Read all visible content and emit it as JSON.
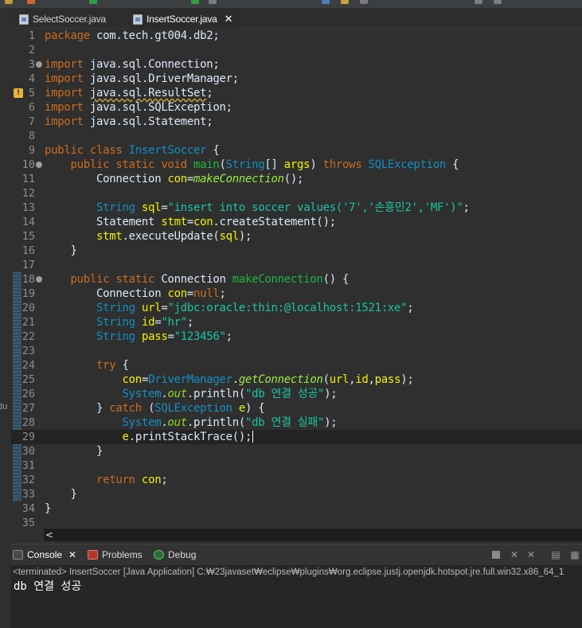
{
  "editor_tabs": [
    {
      "label": "SelectSoccer.java",
      "active": false
    },
    {
      "label": "InsertSoccer.java",
      "active": true,
      "close": "✕"
    }
  ],
  "left_margin_label": "du",
  "code_lines": [
    {
      "num": "1",
      "tokens": [
        {
          "t": "kw",
          "s": "package"
        },
        {
          "t": "p",
          "s": " com.tech.gt004.db2;"
        }
      ]
    },
    {
      "num": "2",
      "tokens": []
    },
    {
      "num": "3",
      "fold": true,
      "tokens": [
        {
          "t": "kw",
          "s": "import"
        },
        {
          "t": "p",
          "s": " java.sql.Connection;"
        }
      ]
    },
    {
      "num": "4",
      "tokens": [
        {
          "t": "kw",
          "s": "import"
        },
        {
          "t": "p",
          "s": " java.sql.DriverManager;"
        }
      ]
    },
    {
      "num": "5",
      "warning": true,
      "tokens": [
        {
          "t": "kw",
          "s": "import"
        },
        {
          "t": "p",
          "s": " "
        },
        {
          "t": "lib",
          "s": "java.sql.ResultSet"
        },
        {
          "t": "p",
          "s": ";"
        }
      ]
    },
    {
      "num": "6",
      "tokens": [
        {
          "t": "kw",
          "s": "import"
        },
        {
          "t": "p",
          "s": " java.sql.SQLException;"
        }
      ]
    },
    {
      "num": "7",
      "tokens": [
        {
          "t": "kw",
          "s": "import"
        },
        {
          "t": "p",
          "s": " java.sql.Statement;"
        }
      ]
    },
    {
      "num": "8",
      "tokens": []
    },
    {
      "num": "9",
      "tokens": [
        {
          "t": "kw",
          "s": "public class "
        },
        {
          "t": "ty",
          "s": "InsertSoccer"
        },
        {
          "t": "p",
          "s": " {"
        }
      ]
    },
    {
      "num": "10",
      "fold": true,
      "tokens": [
        {
          "t": "p",
          "s": "    "
        },
        {
          "t": "kw",
          "s": "public static void "
        },
        {
          "t": "fn",
          "s": "main"
        },
        {
          "t": "p",
          "s": "("
        },
        {
          "t": "ty",
          "s": "String"
        },
        {
          "t": "p",
          "s": "[] "
        },
        {
          "t": "var",
          "s": "args"
        },
        {
          "t": "p",
          "s": ") "
        },
        {
          "t": "kw",
          "s": "throws "
        },
        {
          "t": "ty",
          "s": "SQLException"
        },
        {
          "t": "p",
          "s": " {"
        }
      ]
    },
    {
      "num": "11",
      "tokens": [
        {
          "t": "p",
          "s": "        Connection "
        },
        {
          "t": "var",
          "s": "con"
        },
        {
          "t": "p",
          "s": "="
        },
        {
          "t": "it",
          "s": "makeConnection"
        },
        {
          "t": "p",
          "s": "();"
        }
      ]
    },
    {
      "num": "12",
      "tokens": []
    },
    {
      "num": "13",
      "tokens": [
        {
          "t": "p",
          "s": "        "
        },
        {
          "t": "ty",
          "s": "String"
        },
        {
          "t": "p",
          "s": " "
        },
        {
          "t": "var",
          "s": "sql"
        },
        {
          "t": "p",
          "s": "="
        },
        {
          "t": "str",
          "s": "\"insert into soccer values('7','손흥민2','MF')\""
        },
        {
          "t": "p",
          "s": ";"
        }
      ]
    },
    {
      "num": "14",
      "tokens": [
        {
          "t": "p",
          "s": "        Statement "
        },
        {
          "t": "var",
          "s": "stmt"
        },
        {
          "t": "p",
          "s": "="
        },
        {
          "t": "var",
          "s": "con"
        },
        {
          "t": "p",
          "s": ".createStatement();"
        }
      ]
    },
    {
      "num": "15",
      "tokens": [
        {
          "t": "p",
          "s": "        "
        },
        {
          "t": "var",
          "s": "stmt"
        },
        {
          "t": "p",
          "s": ".executeUpdate("
        },
        {
          "t": "var",
          "s": "sql"
        },
        {
          "t": "p",
          "s": ");"
        }
      ]
    },
    {
      "num": "16",
      "tokens": [
        {
          "t": "p",
          "s": "    }"
        }
      ]
    },
    {
      "num": "17",
      "tokens": []
    },
    {
      "num": "18",
      "fold": true,
      "tokens": [
        {
          "t": "p",
          "s": "    "
        },
        {
          "t": "kw",
          "s": "public static "
        },
        {
          "t": "p",
          "s": "Connection "
        },
        {
          "t": "fn",
          "s": "makeConnection"
        },
        {
          "t": "p",
          "s": "() {"
        }
      ]
    },
    {
      "num": "19",
      "tokens": [
        {
          "t": "p",
          "s": "        Connection "
        },
        {
          "t": "var",
          "s": "con"
        },
        {
          "t": "p",
          "s": "="
        },
        {
          "t": "nul",
          "s": "null"
        },
        {
          "t": "p",
          "s": ";"
        }
      ]
    },
    {
      "num": "20",
      "tokens": [
        {
          "t": "p",
          "s": "        "
        },
        {
          "t": "ty",
          "s": "String"
        },
        {
          "t": "p",
          "s": " "
        },
        {
          "t": "var",
          "s": "url"
        },
        {
          "t": "p",
          "s": "="
        },
        {
          "t": "str",
          "s": "\"jdbc:oracle:thin:@localhost:1521:xe\""
        },
        {
          "t": "p",
          "s": ";"
        }
      ]
    },
    {
      "num": "21",
      "tokens": [
        {
          "t": "p",
          "s": "        "
        },
        {
          "t": "ty",
          "s": "String"
        },
        {
          "t": "p",
          "s": " "
        },
        {
          "t": "var",
          "s": "id"
        },
        {
          "t": "p",
          "s": "="
        },
        {
          "t": "str",
          "s": "\"hr\""
        },
        {
          "t": "p",
          "s": ";"
        }
      ]
    },
    {
      "num": "22",
      "tokens": [
        {
          "t": "p",
          "s": "        "
        },
        {
          "t": "ty",
          "s": "String"
        },
        {
          "t": "p",
          "s": " "
        },
        {
          "t": "var",
          "s": "pass"
        },
        {
          "t": "p",
          "s": "="
        },
        {
          "t": "str",
          "s": "\"123456\""
        },
        {
          "t": "p",
          "s": ";"
        }
      ]
    },
    {
      "num": "23",
      "tokens": []
    },
    {
      "num": "24",
      "tokens": [
        {
          "t": "p",
          "s": "        "
        },
        {
          "t": "kw",
          "s": "try"
        },
        {
          "t": "p",
          "s": " {"
        }
      ]
    },
    {
      "num": "25",
      "tokens": [
        {
          "t": "p",
          "s": "            "
        },
        {
          "t": "var",
          "s": "con"
        },
        {
          "t": "p",
          "s": "="
        },
        {
          "t": "ty",
          "s": "DriverManager"
        },
        {
          "t": "p",
          "s": "."
        },
        {
          "t": "it",
          "s": "getConnection"
        },
        {
          "t": "p",
          "s": "("
        },
        {
          "t": "var",
          "s": "url"
        },
        {
          "t": "p",
          "s": ","
        },
        {
          "t": "var",
          "s": "id"
        },
        {
          "t": "p",
          "s": ","
        },
        {
          "t": "var",
          "s": "pass"
        },
        {
          "t": "p",
          "s": ");"
        }
      ]
    },
    {
      "num": "26",
      "tokens": [
        {
          "t": "p",
          "s": "            "
        },
        {
          "t": "sys",
          "s": "System"
        },
        {
          "t": "p",
          "s": "."
        },
        {
          "t": "out",
          "s": "out"
        },
        {
          "t": "p",
          "s": ".println("
        },
        {
          "t": "str",
          "s": "\"db 연결 성공\""
        },
        {
          "t": "p",
          "s": ");"
        }
      ]
    },
    {
      "num": "27",
      "tokens": [
        {
          "t": "p",
          "s": "        } "
        },
        {
          "t": "kw",
          "s": "catch"
        },
        {
          "t": "p",
          "s": " ("
        },
        {
          "t": "ty",
          "s": "SQLException"
        },
        {
          "t": "p",
          "s": " "
        },
        {
          "t": "var",
          "s": "e"
        },
        {
          "t": "p",
          "s": ") {"
        }
      ]
    },
    {
      "num": "28",
      "tokens": [
        {
          "t": "p",
          "s": "            "
        },
        {
          "t": "sys",
          "s": "System"
        },
        {
          "t": "p",
          "s": "."
        },
        {
          "t": "out",
          "s": "out"
        },
        {
          "t": "p",
          "s": ".println("
        },
        {
          "t": "str",
          "s": "\"db 연결 실패\""
        },
        {
          "t": "p",
          "s": ");"
        }
      ]
    },
    {
      "num": "29",
      "current": true,
      "tokens": [
        {
          "t": "p",
          "s": "            "
        },
        {
          "t": "var",
          "s": "e"
        },
        {
          "t": "p",
          "s": ".printStackTrace();"
        }
      ]
    },
    {
      "num": "30",
      "tokens": [
        {
          "t": "p",
          "s": "        }"
        }
      ]
    },
    {
      "num": "31",
      "tokens": []
    },
    {
      "num": "32",
      "tokens": [
        {
          "t": "p",
          "s": "        "
        },
        {
          "t": "kw",
          "s": "return"
        },
        {
          "t": "p",
          "s": " "
        },
        {
          "t": "var",
          "s": "con"
        },
        {
          "t": "p",
          "s": ";"
        }
      ]
    },
    {
      "num": "33",
      "tokens": [
        {
          "t": "p",
          "s": "    }"
        }
      ]
    },
    {
      "num": "34",
      "tokens": [
        {
          "t": "p",
          "s": "}"
        }
      ]
    },
    {
      "num": "35",
      "tokens": []
    }
  ],
  "scrollbar": {
    "left_arrow": "<"
  },
  "console": {
    "tabs": [
      {
        "label": "Console",
        "active": true,
        "close": "✕"
      },
      {
        "label": "Problems",
        "active": false
      },
      {
        "label": "Debug",
        "active": false
      }
    ],
    "buttons": {
      "remove": "✕",
      "remove_all": "✕",
      "clear": "▤",
      "pin": "▦"
    },
    "status": "<terminated> InsertSoccer [Java Application] C:₩23javaset₩eclipse₩plugins₩org.eclipse.justj.openjdk.hotspot.jre.full.win32.x86_64_1",
    "output": "db 연결 성공"
  },
  "colors": {
    "keyword": "#cc6c1d",
    "type": "#1290c3",
    "method": "#1eb540",
    "string": "#17c6a3",
    "variable": "#f2f200",
    "plain": "#d9e8f7",
    "background": "#2f2f2f"
  }
}
